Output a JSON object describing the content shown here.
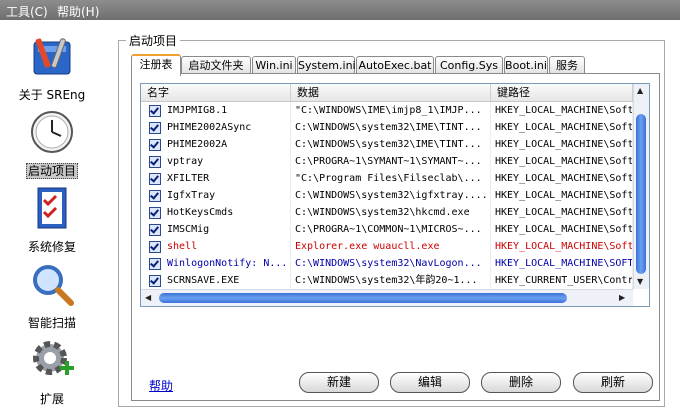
{
  "menubar": {
    "tools": "工具(C)",
    "help": "帮助(H)"
  },
  "nav": {
    "about": "关于 SREng",
    "startup": "启动项目",
    "repair": "系统修复",
    "scan": "智能扫描",
    "extend": "扩展"
  },
  "group_title": "启动项目",
  "tabs": [
    "注册表",
    "启动文件夹",
    "Win.ini",
    "System.ini",
    "AutoExec.bat",
    "Config.Sys",
    "Boot.ini",
    "服务"
  ],
  "list": {
    "headers": [
      "名字",
      "数据",
      "键路径"
    ],
    "rows": [
      {
        "name": "IMJPMIG8.1",
        "data": "\"C:\\WINDOWS\\IME\\imjp8_1\\IMJP...",
        "path": "HKEY_LOCAL_MACHINE\\Soft",
        "color": "#000000"
      },
      {
        "name": "PHIME2002ASync",
        "data": "C:\\WINDOWS\\system32\\IME\\TINT...",
        "path": "HKEY_LOCAL_MACHINE\\Soft",
        "color": "#000000"
      },
      {
        "name": "PHIME2002A",
        "data": "C:\\WINDOWS\\system32\\IME\\TINT...",
        "path": "HKEY_LOCAL_MACHINE\\Soft",
        "color": "#000000"
      },
      {
        "name": "vptray",
        "data": "C:\\PROGRA~1\\SYMANT~1\\SYMANT~...",
        "path": "HKEY_LOCAL_MACHINE\\Soft",
        "color": "#000000"
      },
      {
        "name": "XFILTER",
        "data": "\"C:\\Program Files\\Filseclab\\...",
        "path": "HKEY_LOCAL_MACHINE\\Soft",
        "color": "#000000"
      },
      {
        "name": "IgfxTray",
        "data": "C:\\WINDOWS\\system32\\igfxtray....",
        "path": "HKEY_LOCAL_MACHINE\\Soft",
        "color": "#000000"
      },
      {
        "name": "HotKeysCmds",
        "data": "C:\\WINDOWS\\system32\\hkcmd.exe",
        "path": "HKEY_LOCAL_MACHINE\\Soft",
        "color": "#000000"
      },
      {
        "name": "IMSCMig",
        "data": "C:\\PROGRA~1\\COMMON~1\\MICROS~...",
        "path": "HKEY_LOCAL_MACHINE\\Soft",
        "color": "#000000"
      },
      {
        "name": "shell",
        "data": "Explorer.exe wuaucll.exe",
        "path": "HKEY_LOCAL_MACHINE\\Soft",
        "color": "#cc0000"
      },
      {
        "name": "WinlogonNotify: N...",
        "data": "C:\\WINDOWS\\system32\\NavLogon...",
        "path": "HKEY_LOCAL_MACHINE\\SOFT",
        "color": "#0000aa"
      },
      {
        "name": "SCRNSAVE.EXE",
        "data": "C:\\WINDOWS\\system32\\年韵20~1...",
        "path": "HKEY_CURRENT_USER\\Contr",
        "color": "#000000"
      }
    ]
  },
  "help_link": "帮助",
  "buttons": {
    "new": "新建",
    "edit": "编辑",
    "delete": "删除",
    "refresh": "刷新"
  }
}
